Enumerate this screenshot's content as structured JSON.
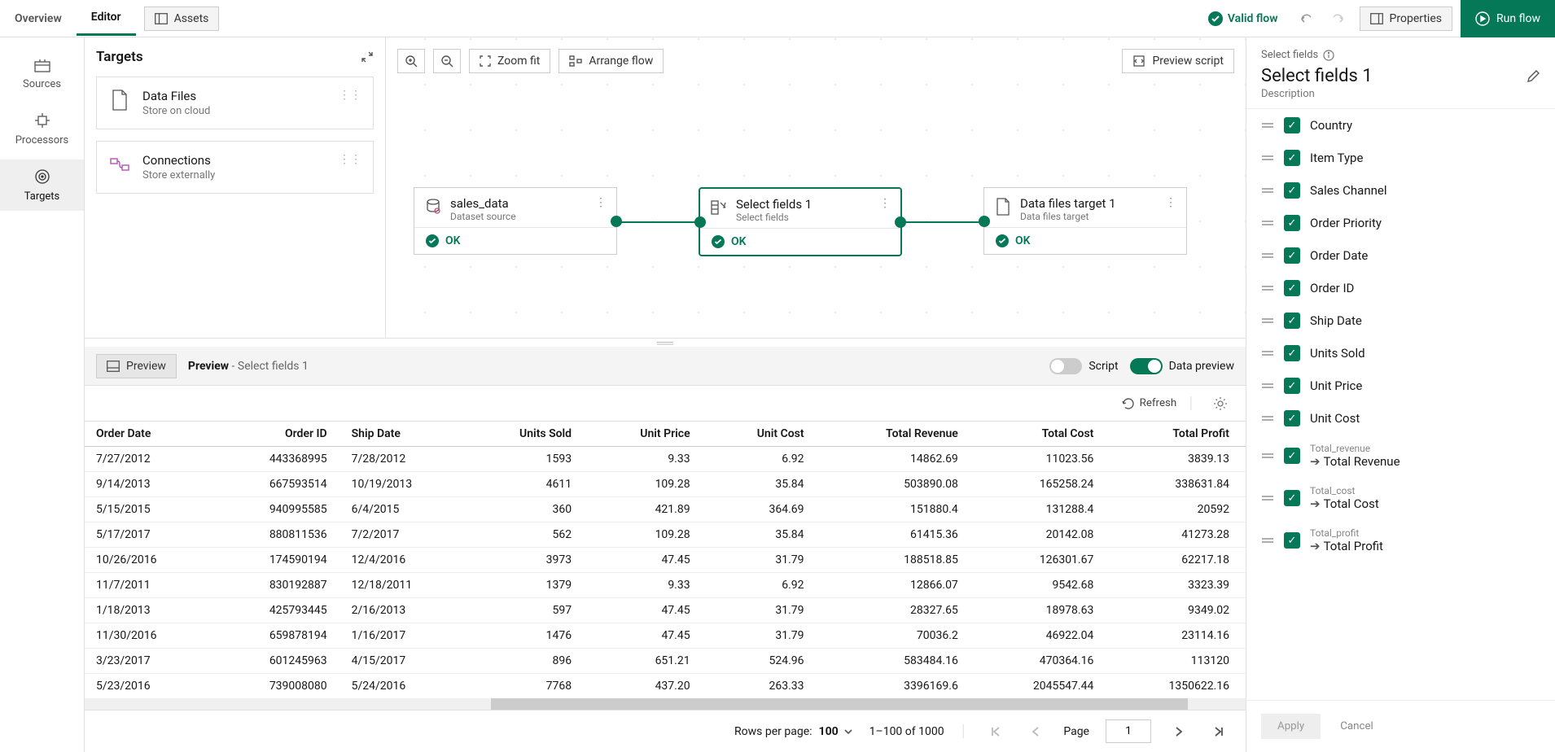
{
  "topbar": {
    "tabs": {
      "overview": "Overview",
      "editor": "Editor"
    },
    "assets": "Assets",
    "valid_flow": "Valid flow",
    "properties": "Properties",
    "run_flow": "Run flow"
  },
  "leftrail": {
    "sources": "Sources",
    "processors": "Processors",
    "targets": "Targets"
  },
  "targets_panel": {
    "title": "Targets",
    "cards": [
      {
        "title": "Data Files",
        "sub": "Store on cloud"
      },
      {
        "title": "Connections",
        "sub": "Store externally"
      }
    ]
  },
  "canvas": {
    "zoom_fit": "Zoom fit",
    "arrange": "Arrange flow",
    "preview_script": "Preview script",
    "nodes": [
      {
        "title": "sales_data",
        "sub": "Dataset source",
        "status": "OK"
      },
      {
        "title": "Select fields 1",
        "sub": "Select fields",
        "status": "OK"
      },
      {
        "title": "Data files target 1",
        "sub": "Data files target",
        "status": "OK"
      }
    ]
  },
  "preview": {
    "preview_btn": "Preview",
    "title_prefix": "Preview",
    "title_suffix": " - Select fields 1",
    "script": "Script",
    "data_preview": "Data preview",
    "refresh": "Refresh",
    "columns": [
      "Order Date",
      "Order ID",
      "Ship Date",
      "Units Sold",
      "Unit Price",
      "Unit Cost",
      "Total Revenue",
      "Total Cost",
      "Total Profit"
    ],
    "rows": [
      [
        "7/27/2012",
        "443368995",
        "7/28/2012",
        "1593",
        "9.33",
        "6.92",
        "14862.69",
        "11023.56",
        "3839.13"
      ],
      [
        "9/14/2013",
        "667593514",
        "10/19/2013",
        "4611",
        "109.28",
        "35.84",
        "503890.08",
        "165258.24",
        "338631.84"
      ],
      [
        "5/15/2015",
        "940995585",
        "6/4/2015",
        "360",
        "421.89",
        "364.69",
        "151880.4",
        "131288.4",
        "20592"
      ],
      [
        "5/17/2017",
        "880811536",
        "7/2/2017",
        "562",
        "109.28",
        "35.84",
        "61415.36",
        "20142.08",
        "41273.28"
      ],
      [
        "10/26/2016",
        "174590194",
        "12/4/2016",
        "3973",
        "47.45",
        "31.79",
        "188518.85",
        "126301.67",
        "62217.18"
      ],
      [
        "11/7/2011",
        "830192887",
        "12/18/2011",
        "1379",
        "9.33",
        "6.92",
        "12866.07",
        "9542.68",
        "3323.39"
      ],
      [
        "1/18/2013",
        "425793445",
        "2/16/2013",
        "597",
        "47.45",
        "31.79",
        "28327.65",
        "18978.63",
        "9349.02"
      ],
      [
        "11/30/2016",
        "659878194",
        "1/16/2017",
        "1476",
        "47.45",
        "31.79",
        "70036.2",
        "46922.04",
        "23114.16"
      ],
      [
        "3/23/2017",
        "601245963",
        "4/15/2017",
        "896",
        "651.21",
        "524.96",
        "583484.16",
        "470364.16",
        "113120"
      ],
      [
        "5/23/2016",
        "739008080",
        "5/24/2016",
        "7768",
        "437.20",
        "263.33",
        "3396169.6",
        "2045547.44",
        "1350622.16"
      ]
    ],
    "pager": {
      "rows_per_page": "Rows per page:",
      "rows_value": "100",
      "range": "1–100 of 1000",
      "page_label": "Page",
      "page_value": "1"
    }
  },
  "rightpanel": {
    "breadcrumb": "Select fields",
    "title": "Select fields 1",
    "desc": "Description",
    "fields": [
      {
        "label": "Country"
      },
      {
        "label": "Item Type"
      },
      {
        "label": "Sales Channel"
      },
      {
        "label": "Order Priority"
      },
      {
        "label": "Order Date"
      },
      {
        "label": "Order ID"
      },
      {
        "label": "Ship Date"
      },
      {
        "label": "Units Sold"
      },
      {
        "label": "Unit Price"
      },
      {
        "label": "Unit Cost"
      },
      {
        "label": "Total Revenue",
        "orig": "Total_revenue"
      },
      {
        "label": "Total Cost",
        "orig": "Total_cost"
      },
      {
        "label": "Total Profit",
        "orig": "Total_profit"
      }
    ],
    "apply": "Apply",
    "cancel": "Cancel"
  }
}
